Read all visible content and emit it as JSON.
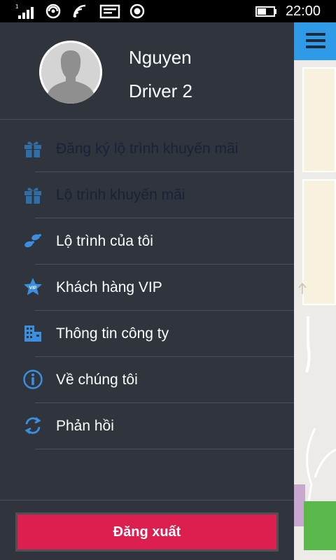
{
  "status_bar": {
    "time": "22:00",
    "icons": [
      "signal-icon",
      "data-icon",
      "wifi-icon",
      "message-icon",
      "location-icon",
      "battery-icon"
    ]
  },
  "profile": {
    "name_line1": "Nguyen",
    "name_line2": "Driver 2"
  },
  "menu": {
    "items": [
      {
        "label": "Đăng ký lộ trình khuyến mãi",
        "icon": "gift-icon",
        "enabled": false
      },
      {
        "label": "Lộ trình khuyến mãi",
        "icon": "gift-icon",
        "enabled": false
      },
      {
        "label": "Lộ trình của tôi",
        "icon": "footsteps-icon",
        "enabled": true
      },
      {
        "label": "Khách hàng VIP",
        "icon": "vip-star-icon",
        "enabled": true
      },
      {
        "label": "Thông tin công ty",
        "icon": "building-icon",
        "enabled": true
      },
      {
        "label": "Về chúng tôi",
        "icon": "info-icon",
        "enabled": true
      },
      {
        "label": "Phản hồi",
        "icon": "feedback-icon",
        "enabled": true
      }
    ]
  },
  "logout": {
    "label": "Đăng xuất"
  },
  "colors": {
    "drawer_bg": "#2f343d",
    "accent_blue": "#2f9ae8",
    "logout_red": "#dc1f4e",
    "disabled_icon": "#2f6ea6"
  }
}
